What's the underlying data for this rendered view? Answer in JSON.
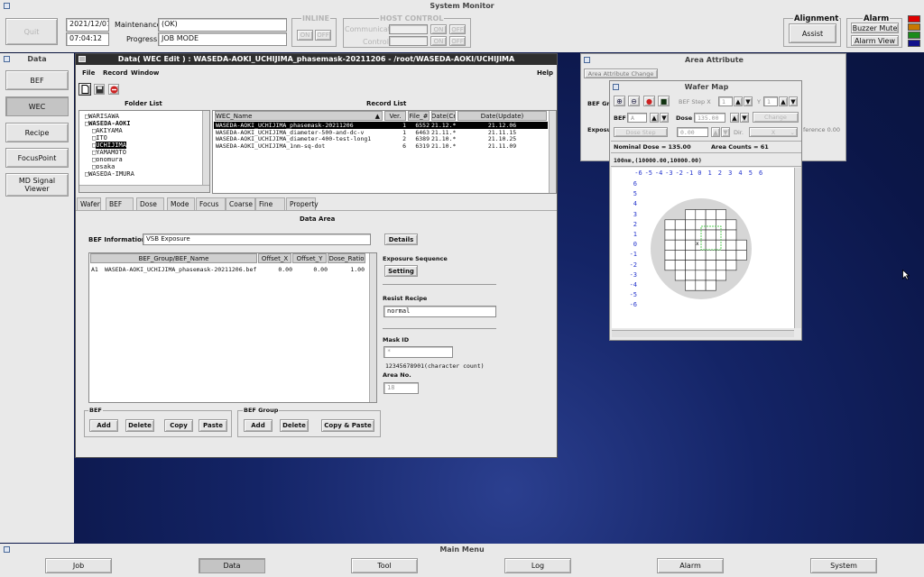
{
  "system_title": "System Monitor",
  "top": {
    "quit_label": "Quit",
    "date": "2021/12/07",
    "time": "07:04:12",
    "maintenance_label": "Maintenance:",
    "maintenance_value": "(OK)",
    "progress_label": "Progress:",
    "progress_value": "JOB MODE",
    "inline_label": "INLINE",
    "on_label": "ON",
    "off_label": "OFF",
    "host_control_label": "HOST CONTROL",
    "communicate_label": "Communicate",
    "control_label": "Control",
    "alignment_label": "Alignment",
    "assist_label": "Assist",
    "alarm_label": "Alarm",
    "buzzer_mute_label": "Buzzer Mute",
    "alarm_view_label": "Alarm View",
    "alarm_colors": [
      "#e00000",
      "#c87800",
      "#1a8a1a",
      "#10108a"
    ]
  },
  "left_panel": {
    "title": "Data",
    "buttons": [
      "BEF",
      "WEC",
      "Recipe",
      "FocusPoint",
      "MD Signal\nViewer"
    ]
  },
  "data_window": {
    "title": "Data( WEC Edit ) : WASEDA-AOKI_UCHIJIMA_phasemask-20211206 - /root/WASEDA-AOKI/UCHIJIMA",
    "menu": [
      "File",
      "Record",
      "Window"
    ],
    "help": "Help",
    "folder_list_title": "Folder List",
    "folders": [
      "WARISAWA",
      "WASEDA-AOKI",
      "AKIYAMA",
      "ITO",
      "UCHIJIMA",
      "YAMAMOTO",
      "onomura",
      "osaka",
      "WASEDA-IMURA"
    ],
    "record_list_title": "Record List",
    "record_headers": [
      "WEC_Name",
      "Ver.",
      "File_#",
      "Date(Cr",
      "Date(Update)"
    ],
    "records": [
      [
        "WASEDA-AOKI_UCHIJIMA_phasemask-20211206",
        "1",
        "6552",
        "21.12.*",
        "21.12.06"
      ],
      [
        "WASEDA-AOKI_UCHIJIMA_diameter-500-and-dc-v",
        "1",
        "6463",
        "21.11.*",
        "21.11.15"
      ],
      [
        "WASEDA-AOKI_UCHIJIMA_diameter-400-test-long1",
        "2",
        "6389",
        "21.10.*",
        "21.10.25"
      ],
      [
        "WASEDA-AOKI_UCHIJIMA_1nm-sq-dot",
        "6",
        "6319",
        "21.10.*",
        "21.11.09"
      ]
    ],
    "tabs": [
      "Wafer",
      "BEF",
      "Dose",
      "Mode",
      "Focus",
      "Coarse",
      "Fine",
      "Property"
    ],
    "data_area_title": "Data Area",
    "bef_information_label": "BEF Information",
    "bef_information_value": "VSB Exposure",
    "details_label": "Details",
    "bef_table_headers": [
      "BEF_Group/BEF_Name",
      "Offset_X",
      "Offset_Y",
      "Dose_Ratio"
    ],
    "bef_rows": [
      [
        "A1",
        "WASEDA-AOKI_UCHIJIMA_phasemask-20211206.bef",
        "0.00",
        "0.00",
        "1.00"
      ]
    ],
    "exposure_sequence_label": "Exposure Sequence",
    "setting_label": "Setting",
    "resist_recipe_label": "Resist Recipe",
    "resist_recipe_value": "normal",
    "mask_id_label": "Mask ID",
    "mask_id_value": "*",
    "char_count_hint": "12345678901(character count)",
    "area_no_label": "Area No.",
    "area_no_value": "18",
    "bef_group_box_label": "BEF",
    "bef_group2_box_label": "BEF Group",
    "add_label": "Add",
    "delete_label": "Delete",
    "copy_label": "Copy",
    "paste_label": "Paste",
    "copy_paste_label": "Copy & Paste"
  },
  "area_attr": {
    "title": "Area Attribute",
    "tab_label": "Area Attribute Change",
    "bef_gr_label": "BEF Gr",
    "exposur_label": "Exposur",
    "ference_text": "ference 0.00"
  },
  "wafer_map": {
    "title": "Wafer Map",
    "bef_step_x_label": "BEF Step X",
    "bef_step_x_value": "1",
    "y_label": "Y",
    "y_value": "1",
    "bef_label": "BEF",
    "bef_value": "A",
    "dose_label": "Dose",
    "dose_value": "135.00",
    "change_label": "Change",
    "dose_step_label": "Dose Step",
    "dose_step_value": "0.00",
    "dir_label": "Dir.",
    "dir_value": "X",
    "nominal_dose": "Nominal Dose = 135.00",
    "area_counts": "Area Counts = 61",
    "coords": "100nm,(10000.00,10000.00)",
    "x_ticks": [
      "-6",
      "-5",
      "-4",
      "-3",
      "-2",
      "-1",
      "0",
      "1",
      "2",
      "3",
      "4",
      "5",
      "6"
    ],
    "y_ticks": [
      "6",
      "5",
      "4",
      "3",
      "2",
      "1",
      "0",
      "-1",
      "-2",
      "-3",
      "-4",
      "-5",
      "-6"
    ]
  },
  "main_menu": {
    "title": "Main Menu",
    "buttons": [
      "Job",
      "Data",
      "Tool",
      "Log",
      "Alarm",
      "System"
    ]
  }
}
